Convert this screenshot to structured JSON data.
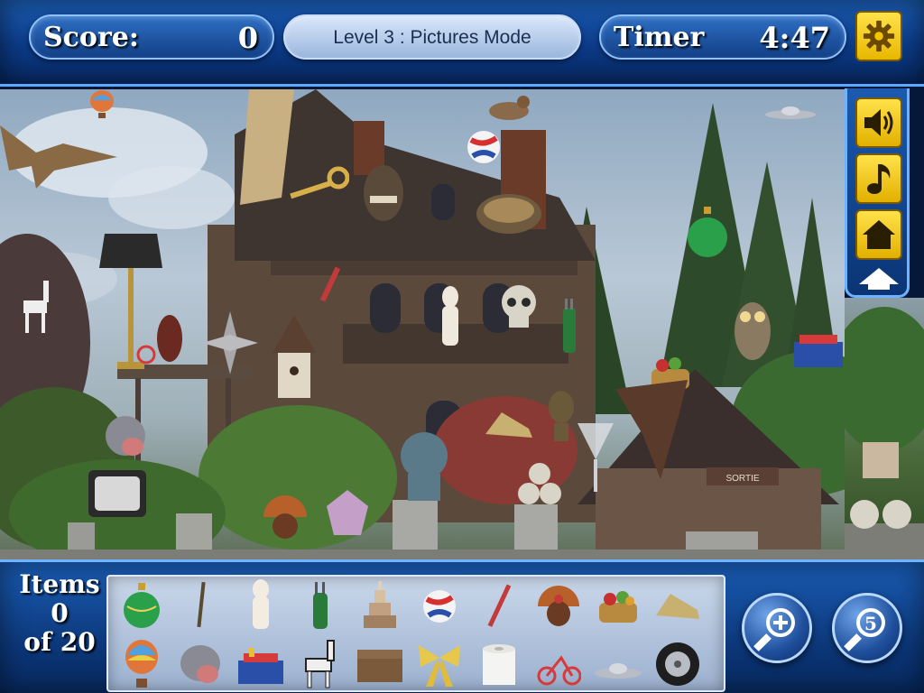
{
  "hud": {
    "score_label": "Score:",
    "score_value": "0",
    "level_text": "Level 3 : Pictures Mode",
    "timer_label": "Timer",
    "timer_value": "4:47"
  },
  "side_panel": {
    "buttons": [
      {
        "name": "sound",
        "icon": "speaker-icon"
      },
      {
        "name": "music",
        "icon": "music-note-icon"
      },
      {
        "name": "home",
        "icon": "home-icon"
      },
      {
        "name": "collapse",
        "icon": "chevron-up-icon"
      }
    ]
  },
  "items": {
    "label": "Items",
    "found": "0",
    "of_text": "of 20"
  },
  "hint": {
    "zoom_icon": "magnifier-plus-icon",
    "hints_remaining": "5"
  },
  "tray_items": [
    "ornament",
    "pencil",
    "statue",
    "golf-bag",
    "cake",
    "volleyball",
    "knife",
    "turkey",
    "fruit-basket",
    "shoe",
    "hot-air-balloon",
    "hippo",
    "toolbox",
    "zebra",
    "chest",
    "bow",
    "toilet-paper",
    "tricycle",
    "ufo",
    "tire"
  ],
  "scene": {
    "sign_text": "SORTIE"
  },
  "colors": {
    "hud_blue": "#0c3a86",
    "button_yellow": "#ffe24a",
    "panel_border": "#6fb2ff"
  }
}
